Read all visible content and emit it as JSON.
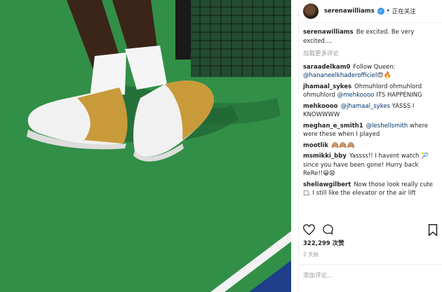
{
  "header": {
    "username": "serenawilliams",
    "verified_mark": "✓",
    "separator": "•",
    "follow_status": "正在关注"
  },
  "caption": {
    "username": "serenawilliams",
    "text": "Be excited. Be very excited...."
  },
  "load_more": "加载更多评论",
  "comments": [
    {
      "user": "saraadelkam0",
      "pre": "Follow Queen: ",
      "mention": "@hananeelkhaderofficiel",
      "post": "",
      "emoji": "😍🔥"
    },
    {
      "user": "jhamaal_sykes",
      "pre": "Ohmuhlord ohmuhlord ohmuhlord ",
      "mention": "@mehkoooo",
      "post": " ITS HAPPENING",
      "emoji": ""
    },
    {
      "user": "mehkoooo",
      "pre": "",
      "mention": "@jhamaal_sykes",
      "post": " YASSS I KNOWWWW",
      "emoji": ""
    },
    {
      "user": "meghan_e_smith1",
      "pre": "",
      "mention": "@leshellsmith",
      "post": " where were these when I played",
      "emoji": ""
    },
    {
      "user": "mootlik",
      "pre": "",
      "mention": "",
      "post": "",
      "emoji": "🙈🙈🙈"
    },
    {
      "user": "msmikki_bby",
      "pre": "Yassss!! I havent watch ",
      "mention": "",
      "post": "",
      "emoji": "🎾 since you have been gone! Hurry back ReRe!!😁😩"
    },
    {
      "user": "sheliawgilbert",
      "pre": "Now those look really cute ",
      "mention": "",
      "post": "",
      "emoji": "□. I still like the elevator or the air lift"
    }
  ],
  "footer": {
    "likes": "322,299 次赞",
    "time": "2 天前",
    "add_comment_placeholder": "添加评论..."
  },
  "icons": [
    "heart-icon",
    "comment-icon",
    "bookmark-icon",
    "verified-badge-icon"
  ],
  "colors": {
    "court": "#2f8a45",
    "link": "#003569",
    "verified": "#3897f0",
    "gold": "#c99a3a"
  }
}
